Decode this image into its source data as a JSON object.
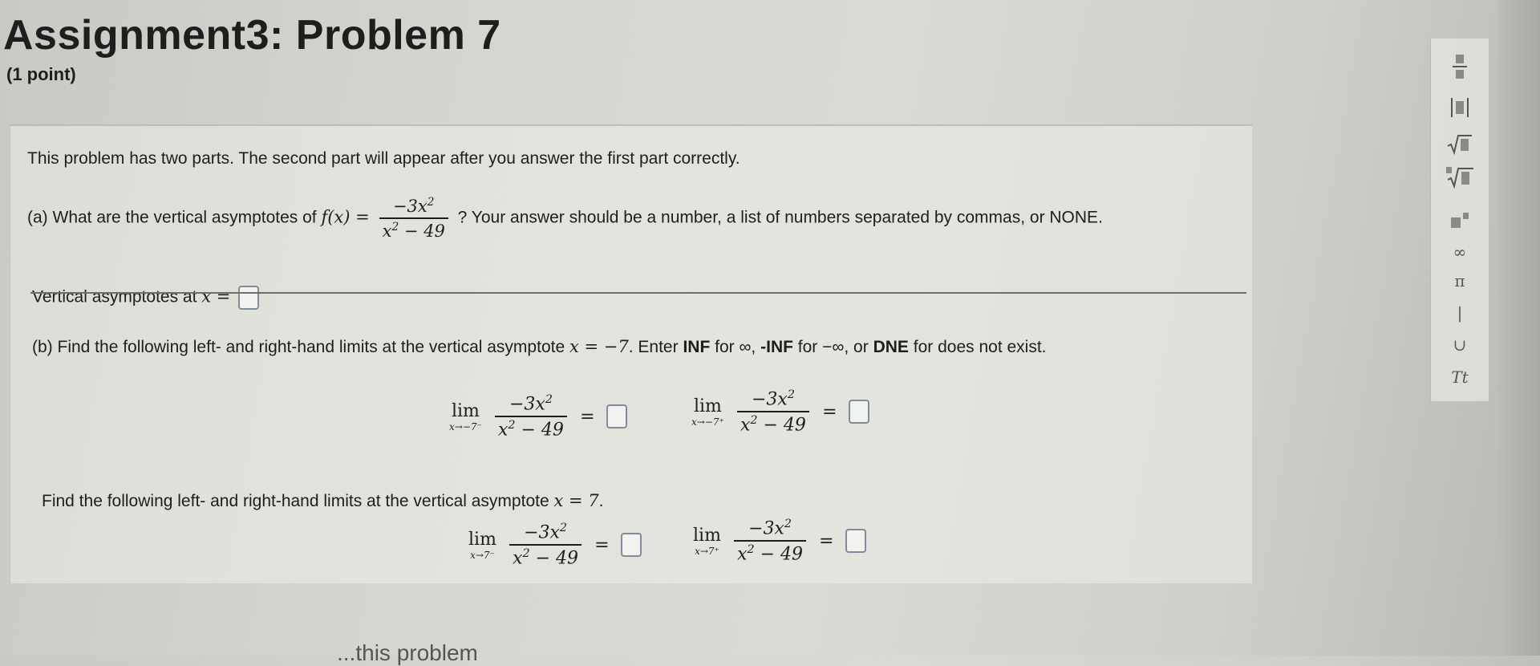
{
  "header": {
    "title": "Assignment3: Problem 7",
    "points": "(1 point)"
  },
  "problem": {
    "intro": "This problem has two parts. The second part will appear after you answer the first part correctly.",
    "part_a": {
      "prefix": "(a) What are the vertical asymptotes of",
      "func_lhs": "f(x) =",
      "numerator": "−3x",
      "num_exp": "2",
      "denominator": "x",
      "den_exp": "2",
      "den_tail": " − 49",
      "suffix": "? Your answer should be a number, a list of numbers separated by commas, or NONE.",
      "answer_label": "Vertical asymptotes at",
      "answer_var": "x =",
      "answer_value": ""
    },
    "part_b": {
      "prefix": "(b) Find the following left- and right-hand limits at the vertical asymptote",
      "asym1": "x = −7",
      "mid1": ". Enter",
      "inf": "INF",
      "for_inf": "for ∞,",
      "neg_inf": "-INF",
      "for_neg_inf": "for −∞, or",
      "dne": "DNE",
      "for_dne": "for does not exist.",
      "second_prefix": "Find the following left- and right-hand limits at the vertical asymptote",
      "asym2": "x = 7",
      "second_suffix": ".",
      "lim_word": "lim",
      "sub_left_neg7": "x→−7⁻",
      "sub_right_neg7": "x→−7⁺",
      "sub_left_7": "x→7⁻",
      "sub_right_7": "x→7⁺",
      "frac_num": "−3x",
      "frac_num_exp": "2",
      "frac_den": "x",
      "frac_den_exp": "2",
      "frac_den_tail": " − 49",
      "equals": "="
    }
  },
  "toolbar": {
    "items": [
      "fraction-icon",
      "absolute-value-icon",
      "square-root-icon",
      "nth-root-icon",
      "exponent-icon",
      "∞",
      "π",
      "|",
      "∪",
      "Tt"
    ]
  },
  "footer": {
    "cut_text": "...this problem"
  }
}
